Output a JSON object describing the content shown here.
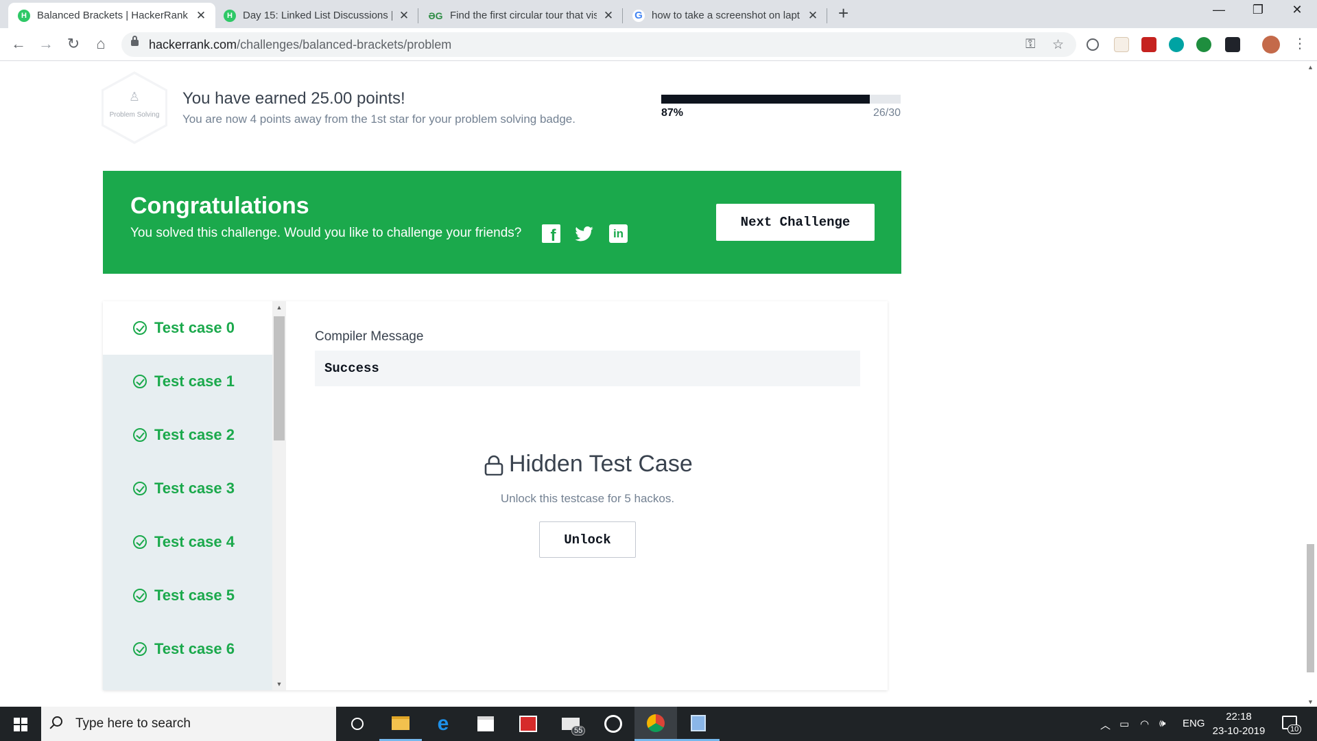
{
  "browser": {
    "tabs": [
      {
        "favicon": "hackerrank-favicon",
        "title": "Balanced Brackets | HackerRank",
        "active": true
      },
      {
        "favicon": "hackerrank-favicon",
        "title": "Day 15: Linked List Discussions | T",
        "active": false
      },
      {
        "favicon": "geeksforgeeks-favicon",
        "title": "Find the first circular tour that vis",
        "active": false
      },
      {
        "favicon": "google-favicon",
        "title": "how to take a screenshot on lapt",
        "active": false
      }
    ],
    "new_tab": "+",
    "url_host": "hackerrank.com",
    "url_path": "/challenges/balanced-brackets/problem"
  },
  "badge": {
    "label": "Problem Solving",
    "earned_title": "You have earned 25.00 points!",
    "earned_subtitle": "You are now 4 points away from the 1st star for your problem solving badge.",
    "progress_percent": 87,
    "progress_percent_label": "87%",
    "progress_count": "26/30"
  },
  "congrats": {
    "title": "Congratulations",
    "subtitle": "You solved this challenge. Would you like to challenge your friends?",
    "next_button": "Next Challenge",
    "background_color": "#1ba94c"
  },
  "test_cases": {
    "items": [
      {
        "label": "Test case 0",
        "status": "passed",
        "active": true
      },
      {
        "label": "Test case 1",
        "status": "passed",
        "active": false
      },
      {
        "label": "Test case 2",
        "status": "passed",
        "active": false
      },
      {
        "label": "Test case 3",
        "status": "passed",
        "active": false
      },
      {
        "label": "Test case 4",
        "status": "passed",
        "active": false
      },
      {
        "label": "Test case 5",
        "status": "passed",
        "active": false
      },
      {
        "label": "Test case 6",
        "status": "passed",
        "active": false
      }
    ],
    "compiler_label": "Compiler Message",
    "compiler_message": "Success",
    "hidden_title": "Hidden Test Case",
    "hidden_subtitle": "Unlock this testcase for 5 hackos.",
    "unlock_button": "Unlock"
  },
  "taskbar": {
    "search_placeholder": "Type here to search",
    "mail_badge": "55",
    "language": "ENG",
    "time": "22:18",
    "date": "23-10-2019",
    "notification_count": "10"
  }
}
